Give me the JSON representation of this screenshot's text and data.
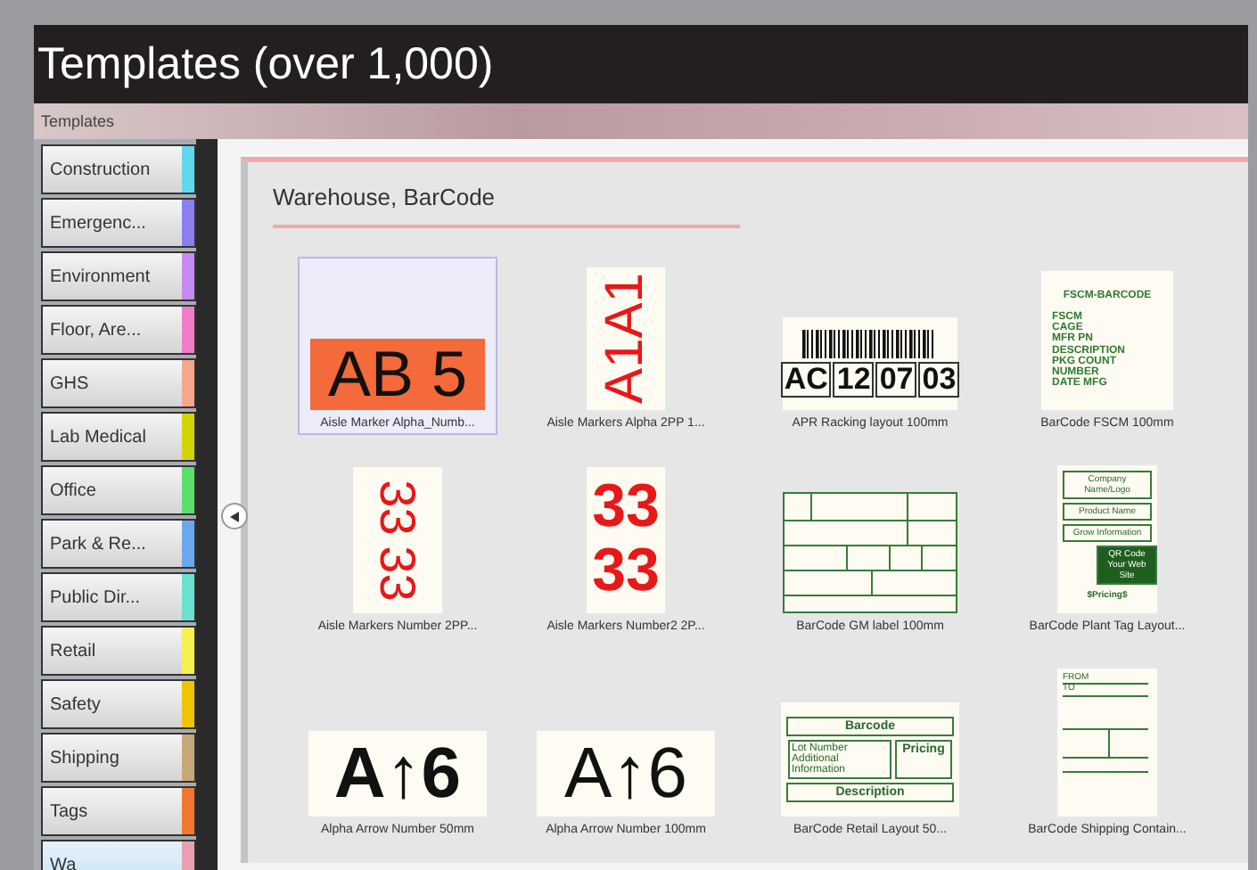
{
  "banner": {
    "title": "Templates (over 1,000)"
  },
  "window": {
    "title": "Templates"
  },
  "sidebar": {
    "items": [
      {
        "label": "Construction",
        "color": "#5fd8ee",
        "selected": false
      },
      {
        "label": "Emergenc...",
        "color": "#8a7ef0",
        "selected": false
      },
      {
        "label": "Environment",
        "color": "#c88af0",
        "selected": false
      },
      {
        "label": "Floor, Are...",
        "color": "#f07ccc",
        "selected": false
      },
      {
        "label": "GHS",
        "color": "#f5a88a",
        "selected": false
      },
      {
        "label": "Lab Medical",
        "color": "#d4d400",
        "selected": false
      },
      {
        "label": "Office",
        "color": "#5cde6a",
        "selected": false
      },
      {
        "label": "Park & Re...",
        "color": "#6aa8ee",
        "selected": false
      },
      {
        "label": "Public Dir...",
        "color": "#6ae0d0",
        "selected": false
      },
      {
        "label": "Retail",
        "color": "#f8f050",
        "selected": false
      },
      {
        "label": "Safety",
        "color": "#f0c400",
        "selected": false
      },
      {
        "label": "Shipping",
        "color": "#c8a878",
        "selected": false
      },
      {
        "label": "Tags",
        "color": "#f07830",
        "selected": false
      },
      {
        "label": "Wa",
        "color": "#e8a0b0",
        "selected": true
      }
    ]
  },
  "group": {
    "title": "Warehouse, BarCode",
    "templates": [
      {
        "name": "Aisle Marker Alpha_Numb...",
        "selected": true,
        "kind": "block",
        "lines": [
          "AB 5"
        ]
      },
      {
        "name": "Aisle Markers Alpha 2PP 1...",
        "selected": false,
        "kind": "rotated",
        "lines": [
          "A1A1"
        ]
      },
      {
        "name": "APR Racking layout 100mm",
        "selected": false,
        "kind": "racking",
        "lines": [
          "AC",
          "12",
          "07",
          "03"
        ]
      },
      {
        "name": "BarCode FSCM 100mm",
        "selected": false,
        "kind": "form",
        "lines": [
          "FSCM-BARCODE",
          "FSCM",
          "CAGE",
          "MFR PN",
          "DESCRIPTION",
          "PKG COUNT",
          "NUMBER",
          "DATE MFG"
        ]
      },
      {
        "name": "Aisle Markers Number 2PP...",
        "selected": false,
        "kind": "stacked",
        "rotated": true,
        "lines": [
          "33",
          "33"
        ]
      },
      {
        "name": "Aisle Markers Number2 2P...",
        "selected": false,
        "kind": "stacked",
        "rotated": false,
        "lines": [
          "33",
          "33"
        ]
      },
      {
        "name": "BarCode GM label 100mm",
        "selected": false,
        "kind": "grid"
      },
      {
        "name": "BarCode Plant Tag Layout...",
        "selected": false,
        "kind": "plant",
        "lines": [
          "Company Name/Logo",
          "Product Name",
          "Grow Information",
          "QR Code Your Web Site",
          "$Pricing$"
        ]
      },
      {
        "name": "Alpha Arrow Number 50mm",
        "selected": false,
        "kind": "bigtext",
        "bold": true,
        "lines": [
          "A↑6"
        ]
      },
      {
        "name": "Alpha Arrow Number 100mm",
        "selected": false,
        "kind": "bigtext",
        "bold": false,
        "lines": [
          "A↑6"
        ]
      },
      {
        "name": "BarCode Retail Layout 50...",
        "selected": false,
        "kind": "retail",
        "lines": [
          "Barcode",
          "Lot Number Additional Information",
          "Pricing",
          "Description"
        ]
      },
      {
        "name": "BarCode Shipping Contain...",
        "selected": false,
        "kind": "shipping",
        "lines": [
          "FROM",
          "TO"
        ]
      }
    ]
  }
}
